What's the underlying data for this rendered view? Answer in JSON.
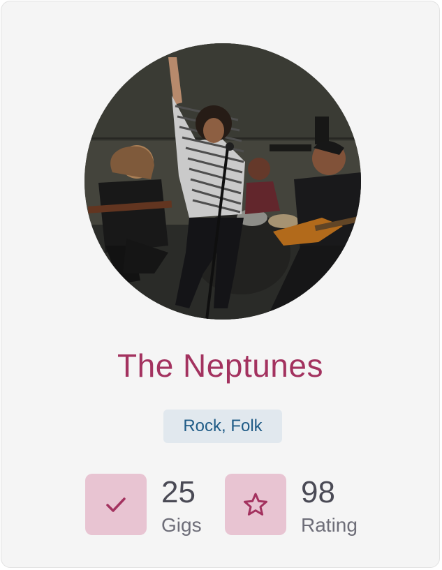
{
  "profile": {
    "name": "The Neptunes",
    "genres": "Rock, Folk"
  },
  "stats": {
    "gigs": {
      "value": "25",
      "label": "Gigs",
      "icon": "check-icon"
    },
    "rating": {
      "value": "98",
      "label": "Rating",
      "icon": "star-icon"
    }
  },
  "colors": {
    "accent": "#a3325f",
    "icon_bg": "#e8c4d2",
    "badge_bg": "#e1e8ee",
    "badge_text": "#1f5b86",
    "card_bg": "#f5f5f5"
  }
}
